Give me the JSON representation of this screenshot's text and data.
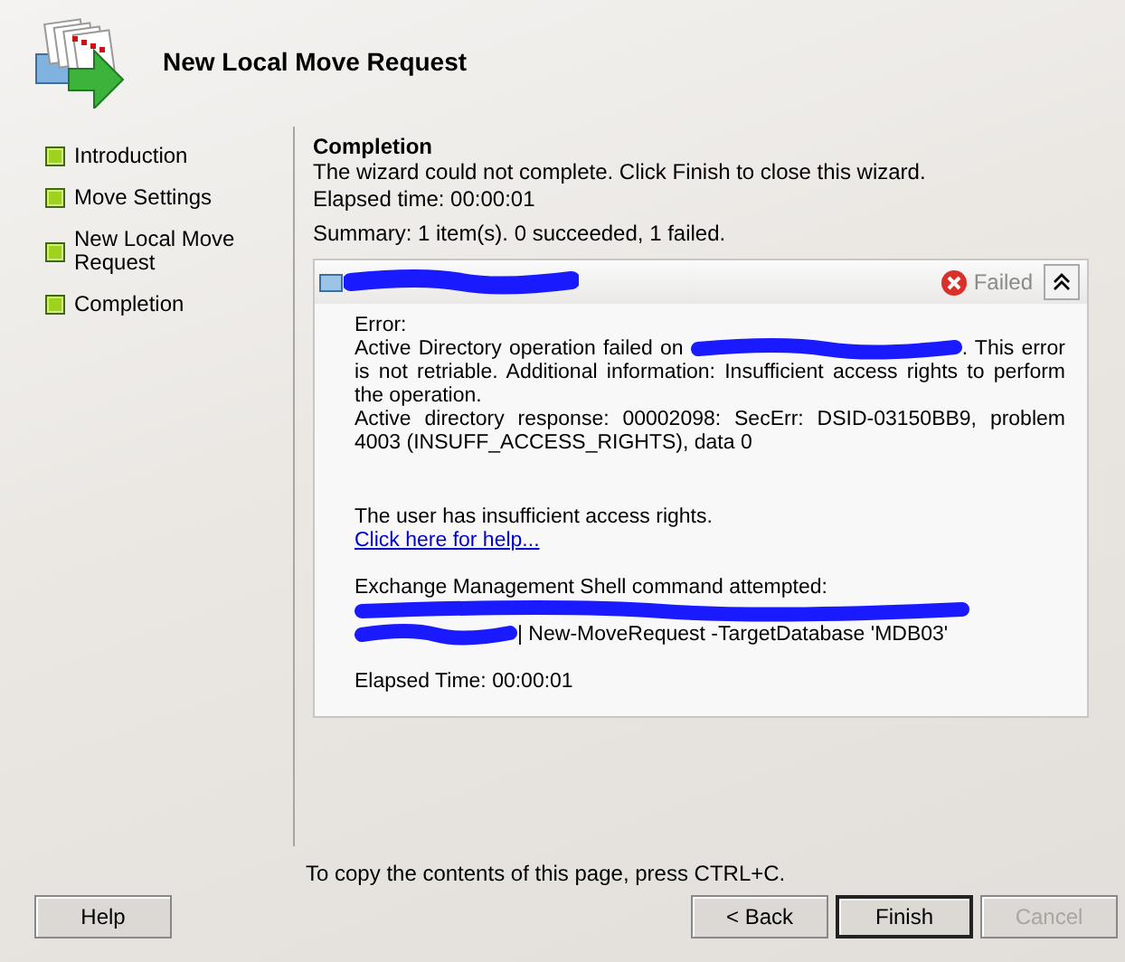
{
  "window": {
    "title": "New Local Move Request"
  },
  "steps": [
    {
      "label": "Introduction"
    },
    {
      "label": "Move Settings"
    },
    {
      "label": "New Local Move Request"
    },
    {
      "label": "Completion"
    }
  ],
  "page": {
    "heading": "Completion",
    "message": "The wizard could not complete. Click Finish to close this wizard.",
    "elapsed": "Elapsed time: 00:00:01",
    "summary": "Summary: 1 item(s). 0 succeeded, 1 failed."
  },
  "item": {
    "status": "Failed",
    "expanded": true,
    "error_label": "Error:",
    "error_start": "Active Directory operation failed on",
    "error_rest": ". This error is not retriable. Additional information: Insufficient access rights to perform the operation.",
    "response": "Active directory response: 00002098: SecErr: DSID-03150BB9, problem 4003 (INSUFF_ACCESS_RIGHTS), data 0",
    "user_message": "The user has insufficient access rights.",
    "help_link": "Click here for help...",
    "command_label": "Exchange Management Shell command attempted:",
    "command": "| New-MoveRequest -TargetDatabase 'MDB03'",
    "elapsed": "Elapsed Time: 00:00:01"
  },
  "footer_note": "To copy the contents of this page, press CTRL+C.",
  "buttons": [
    {
      "label": "Help",
      "kind": "help",
      "disabled": false,
      "default": false
    },
    {
      "label": "< Back",
      "kind": "nav",
      "disabled": false,
      "default": false
    },
    {
      "label": "Finish",
      "kind": "nav",
      "disabled": false,
      "default": true
    },
    {
      "label": "Cancel",
      "kind": "nav",
      "disabled": true,
      "default": false
    }
  ]
}
